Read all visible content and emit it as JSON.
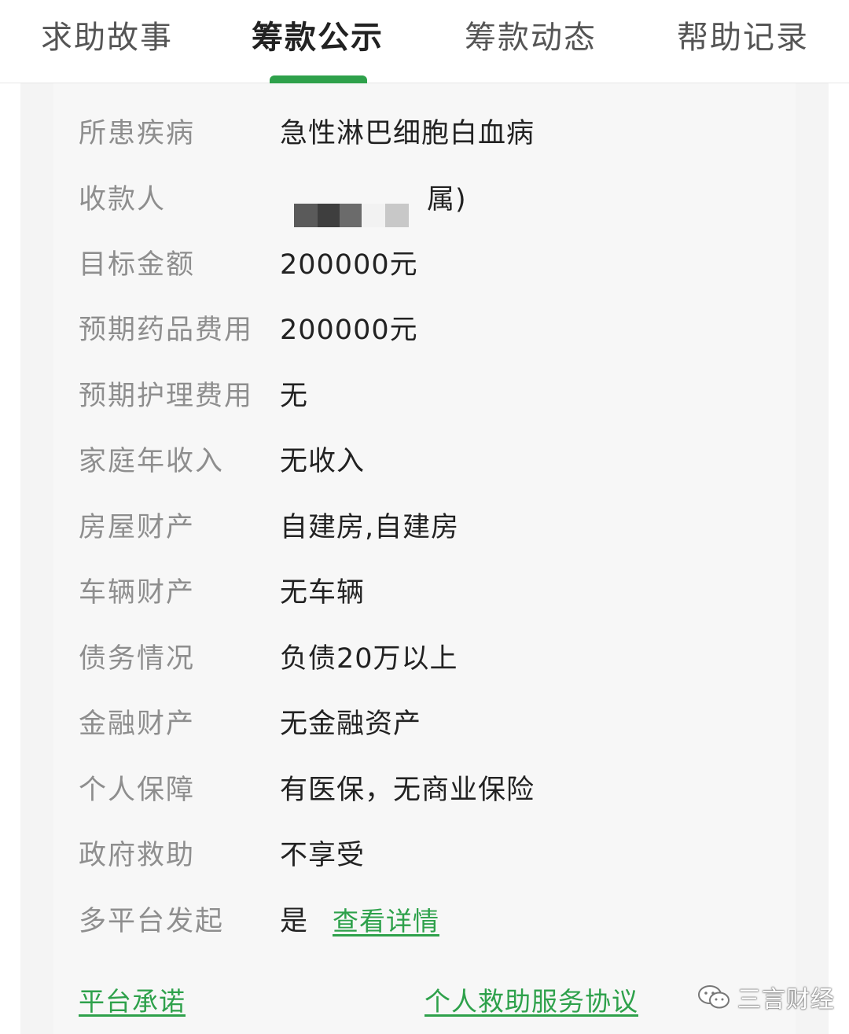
{
  "tabs": [
    {
      "label": "求助故事",
      "active": false
    },
    {
      "label": "筹款公示",
      "active": true
    },
    {
      "label": "筹款动态",
      "active": false
    },
    {
      "label": "帮助记录",
      "active": false
    }
  ],
  "accent_color": "#2ea14b",
  "details": {
    "disease": {
      "label": "所患疾病",
      "value": "急性淋巴细胞白血病"
    },
    "payee": {
      "label": "收款人",
      "value": "属)"
    },
    "target_amount": {
      "label": "目标金额",
      "value": "200000元"
    },
    "expected_drug_cost": {
      "label": "预期药品费用",
      "value": "200000元"
    },
    "expected_care_cost": {
      "label": "预期护理费用",
      "value": "无"
    },
    "family_income": {
      "label": "家庭年收入",
      "value": "无收入"
    },
    "house_property": {
      "label": "房屋财产",
      "value": "自建房,自建房"
    },
    "vehicle_property": {
      "label": "车辆财产",
      "value": "无车辆"
    },
    "debt": {
      "label": "债务情况",
      "value": "负债20万以上"
    },
    "financial_assets": {
      "label": "金融财产",
      "value": "无金融资产"
    },
    "personal_insurance": {
      "label": "个人保障",
      "value": "有医保，无商业保险"
    },
    "government_aid": {
      "label": "政府救助",
      "value": "不享受"
    },
    "multi_platform": {
      "label": "多平台发起",
      "value": "是",
      "link": "查看详情"
    }
  },
  "footer": {
    "platform_promise": "平台承诺",
    "service_agreement": "个人救助服务协议"
  },
  "watermark": {
    "text": "三言财经",
    "icon": "wechat-icon"
  }
}
